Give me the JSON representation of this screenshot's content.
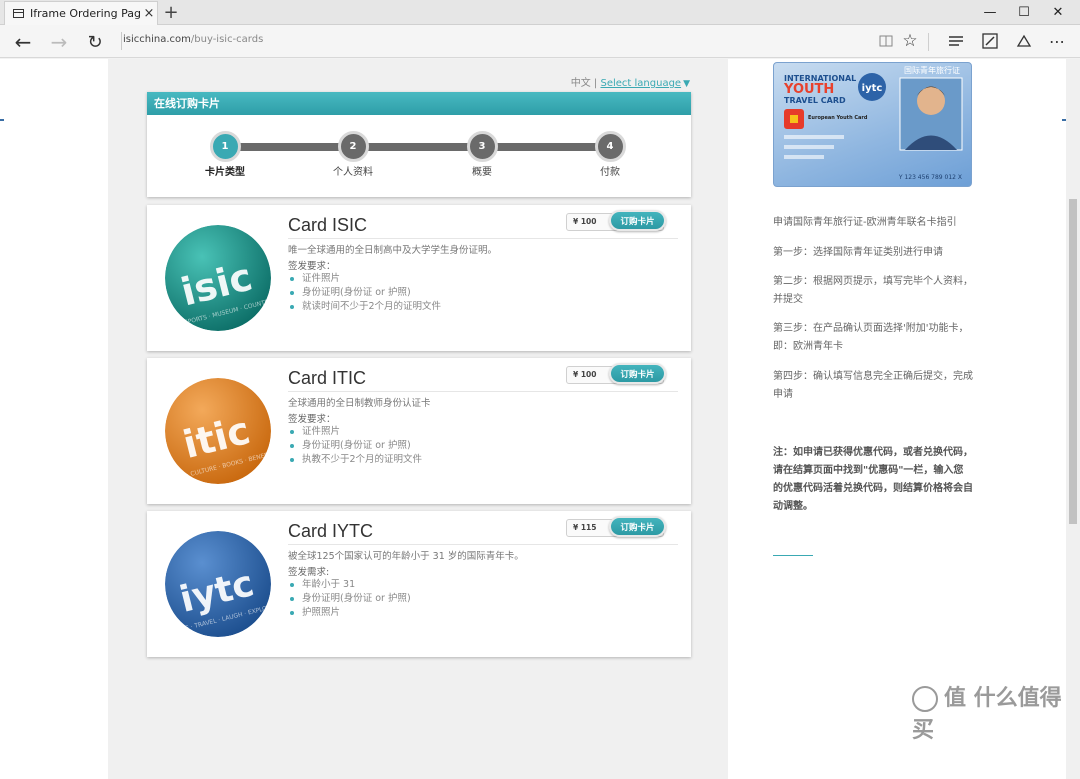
{
  "browser": {
    "tab_title": "Iframe Ordering Page - I",
    "tab_close": "×",
    "new_tab": "+",
    "url_host": "isicchina.com",
    "url_path": "/buy-isic-cards",
    "window_controls": [
      "—",
      "☐",
      "✕"
    ]
  },
  "page": {
    "lang_current": "中文 | ",
    "lang_select": "Select language",
    "order_title": "在线订购卡片",
    "steps": [
      {
        "num": "1",
        "label": "卡片类型"
      },
      {
        "num": "2",
        "label": "个人资料"
      },
      {
        "num": "3",
        "label": "概要"
      },
      {
        "num": "4",
        "label": "付款"
      }
    ],
    "cards": [
      {
        "title": "Card ISIC",
        "badge_text": "isic",
        "badge_sub": "MUSIC · ART · SPORTS · MUSEUM · COUNTRIES · THEATRE",
        "price": "¥ 100",
        "buy_label": "订购卡片",
        "desc": "唯一全球通用的全日制高中及大学学生身份证明。",
        "req_label": "签发要求：",
        "requirements": [
          "证件照片",
          "身份证明(身份证 or 护照)",
          "就读时间不少于2个月的证明文件"
        ],
        "color_light": "#49c2b6",
        "color_dark": "#0d6f68"
      },
      {
        "title": "Card ITIC",
        "badge_text": "itic",
        "badge_sub": "GALLERIES · CULTURE · BOOKS · BENEFITS · ENJOY",
        "price": "¥ 100",
        "buy_label": "订购卡片",
        "desc": "全球通用的全日制教师身份认证卡",
        "req_label": "签发要求：",
        "requirements": [
          "证件照片",
          "身份证明(身份证 or 护照)",
          "执教不少于2个月的证明文件"
        ],
        "color_light": "#f3a95a",
        "color_dark": "#c9690f"
      },
      {
        "title": "Card IYTC",
        "badge_text": "iytc",
        "badge_sub": "ADVENTURE · TRAVEL · LAUGH · EXPLORE · SHOPS",
        "price": "¥ 115",
        "buy_label": "订购卡片",
        "desc": "被全球125个国家认可的年龄小于 31 岁的国际青年卡。",
        "req_label": "签发需求:",
        "requirements": [
          "年龄小于 31",
          "身份证明(身份证 or 护照)",
          "护照照片"
        ],
        "color_light": "#5a8fd0",
        "color_dark": "#1d4f8f"
      }
    ]
  },
  "sidebar": {
    "promo": {
      "line1": "INTERNATIONAL",
      "line2": "YOUTH",
      "line3": "TRAVEL CARD",
      "cn_title": "国际青年旅行证",
      "logo": "iytc",
      "eyca": "European Youth Card",
      "number": "Y 123 456 789 012 X"
    },
    "guide_title": "申请国际青年旅行证-欧洲青年联名卡指引",
    "steps": [
      "第一步：选择国际青年证类别进行申请",
      "第二步：根据网页提示，填写完毕个人资料，并提交",
      "第三步：在产品确认页面选择'附加'功能卡，即：欧洲青年卡",
      "第四步：确认填写信息完全正确后提交，完成申请"
    ],
    "note": "注：如申请已获得优惠代码，或者兑换代码，请在结算页面中找到\"优惠码\"一栏，输入您的优惠代码活着兑换代码，则结算价格将会自动调整。"
  },
  "watermark": "值 什么值得买",
  "colors": {
    "accent": "#3aa9b3",
    "step_grey": "#6a6a6a"
  }
}
